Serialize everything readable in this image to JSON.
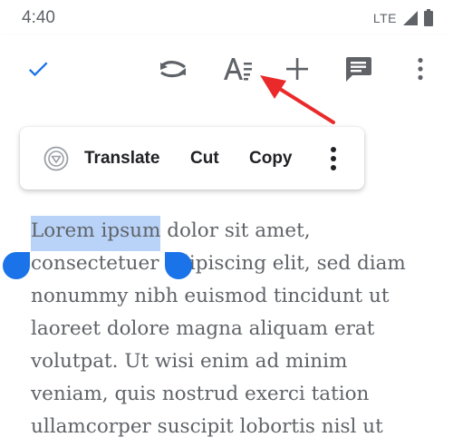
{
  "status_bar": {
    "time": "4:40",
    "network": "LTE",
    "icons": [
      "signal-icon",
      "battery-icon"
    ]
  },
  "toolbar": {
    "buttons": [
      "check-icon",
      "undo-icon",
      "text-format-icon",
      "add-icon",
      "comment-icon",
      "more-vert-icon"
    ]
  },
  "context_menu": {
    "translate_label": "Translate",
    "cut_label": "Cut",
    "copy_label": "Copy"
  },
  "document": {
    "selected_text": "Lorem ipsum",
    "lines": [
      " dolor sit amet,",
      "consectetuer adipiscing elit, sed diam",
      "nonummy nibh euismod tincidunt ut",
      "laoreet dolore magna aliquam erat",
      "volutpat. Ut wisi enim ad minim",
      "veniam, quis nostrud exerci tation",
      "ullamcorper suscipit lobortis nisl ut"
    ]
  },
  "colors": {
    "accent": "#1a73e8",
    "selection": "#b9d3f8",
    "annotation_arrow": "#ea2a2a"
  }
}
